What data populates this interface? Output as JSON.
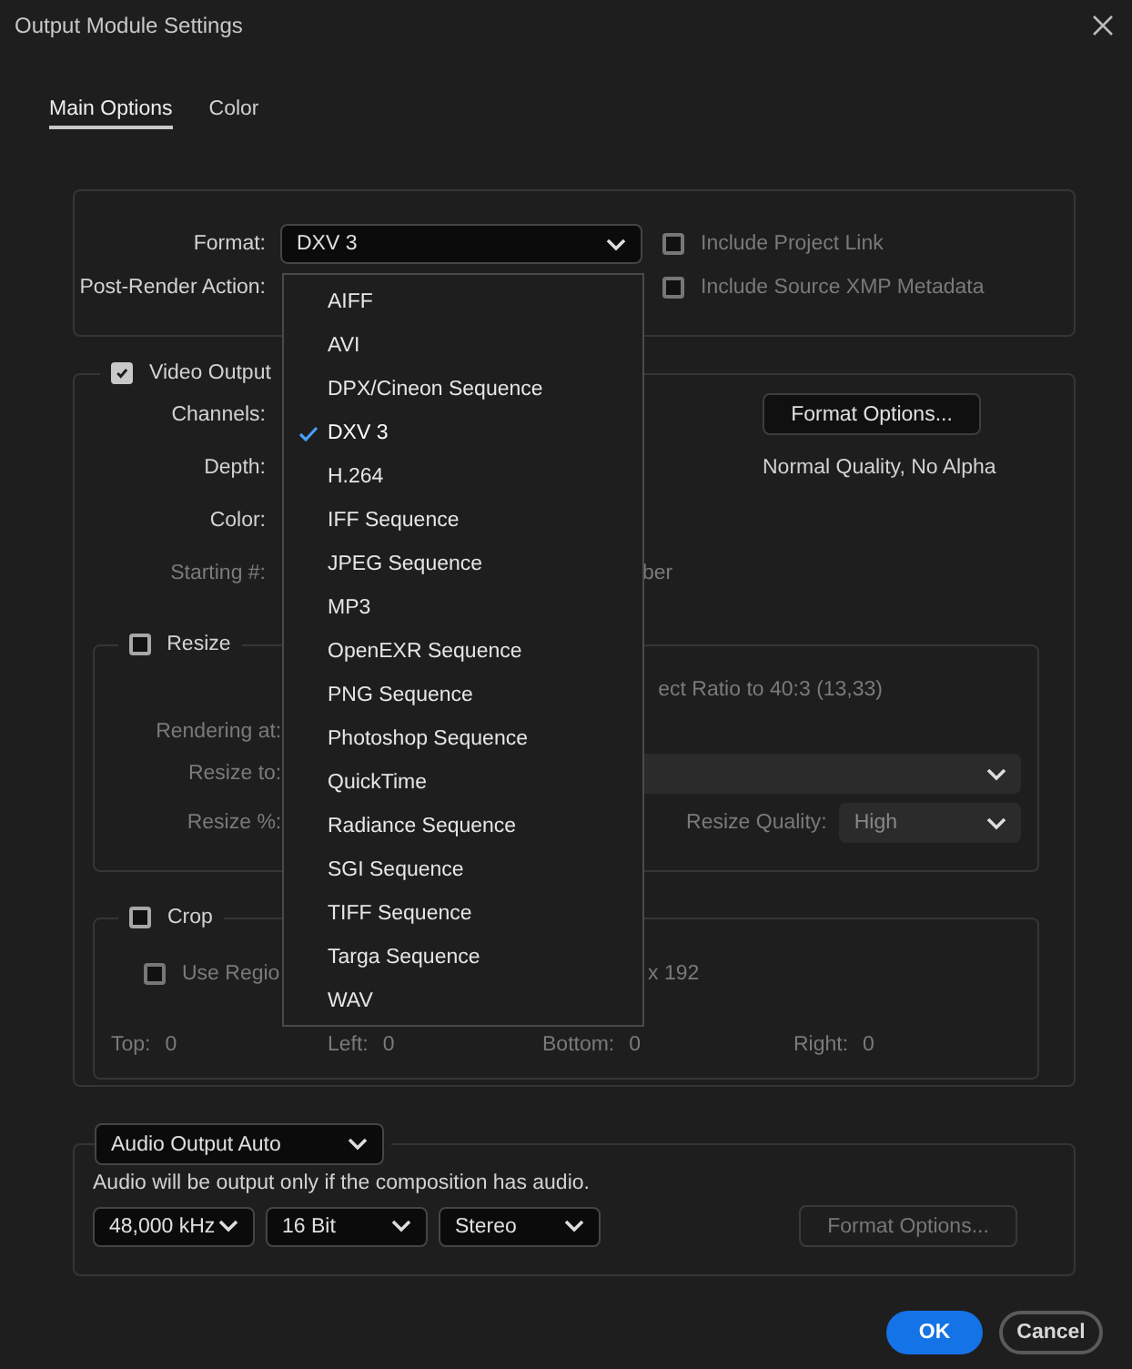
{
  "window": {
    "title": "Output Module Settings"
  },
  "tabs": [
    {
      "label": "Main Options",
      "selected": true
    },
    {
      "label": "Color",
      "selected": false
    }
  ],
  "output": {
    "format_label": "Format:",
    "format_value": "DXV 3",
    "post_render_label": "Post-Render Action:",
    "options": [
      {
        "label": "Include Project Link",
        "checked": false,
        "disabled": true
      },
      {
        "label": "Include Source XMP Metadata",
        "checked": false,
        "disabled": true
      }
    ]
  },
  "format_menu": {
    "items": [
      {
        "label": "AIFF",
        "selected": false
      },
      {
        "label": "AVI",
        "selected": false
      },
      {
        "label": "DPX/Cineon Sequence",
        "selected": false
      },
      {
        "label": "DXV 3",
        "selected": true
      },
      {
        "label": "H.264",
        "selected": false
      },
      {
        "label": "IFF Sequence",
        "selected": false
      },
      {
        "label": "JPEG Sequence",
        "selected": false
      },
      {
        "label": "MP3",
        "selected": false
      },
      {
        "label": "OpenEXR Sequence",
        "selected": false
      },
      {
        "label": "PNG Sequence",
        "selected": false
      },
      {
        "label": "Photoshop Sequence",
        "selected": false
      },
      {
        "label": "QuickTime",
        "selected": false
      },
      {
        "label": "Radiance Sequence",
        "selected": false
      },
      {
        "label": "SGI Sequence",
        "selected": false
      },
      {
        "label": "TIFF Sequence",
        "selected": false
      },
      {
        "label": "Targa Sequence",
        "selected": false
      },
      {
        "label": "WAV",
        "selected": false
      }
    ]
  },
  "video_output": {
    "label": "Video Output",
    "checked": true,
    "format_options_button": "Format Options...",
    "summary": "Normal Quality, No Alpha",
    "rows": [
      {
        "label": "Channels:",
        "disabled": false
      },
      {
        "label": "Depth:",
        "disabled": false
      },
      {
        "label": "Color:",
        "disabled": false
      },
      {
        "label": "Starting #:",
        "disabled": true,
        "trailing": "ber"
      }
    ]
  },
  "resize": {
    "label": "Resize",
    "checked": false,
    "aspect_text": "ect Ratio to 40:3 (13,33)",
    "rendering_at_label": "Rendering at:",
    "resize_to_label": "Resize to:",
    "resize_percent_label": "Resize %:",
    "quality_label": "Resize Quality:",
    "quality_value": "High"
  },
  "crop": {
    "label": "Crop",
    "checked": false,
    "use_region": {
      "label": "Use Regio",
      "checked": false
    },
    "region_size": "x 192",
    "fields": [
      {
        "label": "Top:",
        "value": "0"
      },
      {
        "label": "Left:",
        "value": "0"
      },
      {
        "label": "Bottom:",
        "value": "0"
      },
      {
        "label": "Right:",
        "value": "0"
      }
    ]
  },
  "audio": {
    "mode": "Audio Output Auto",
    "note": "Audio will be output only if the composition has audio.",
    "selects": [
      "48,000 kHz",
      "16 Bit",
      "Stereo"
    ],
    "format_options_button": "Format Options...",
    "format_options_disabled": true
  },
  "buttons": [
    {
      "label": "OK",
      "kind": "primary"
    },
    {
      "label": "Cancel",
      "kind": "secondary"
    }
  ]
}
